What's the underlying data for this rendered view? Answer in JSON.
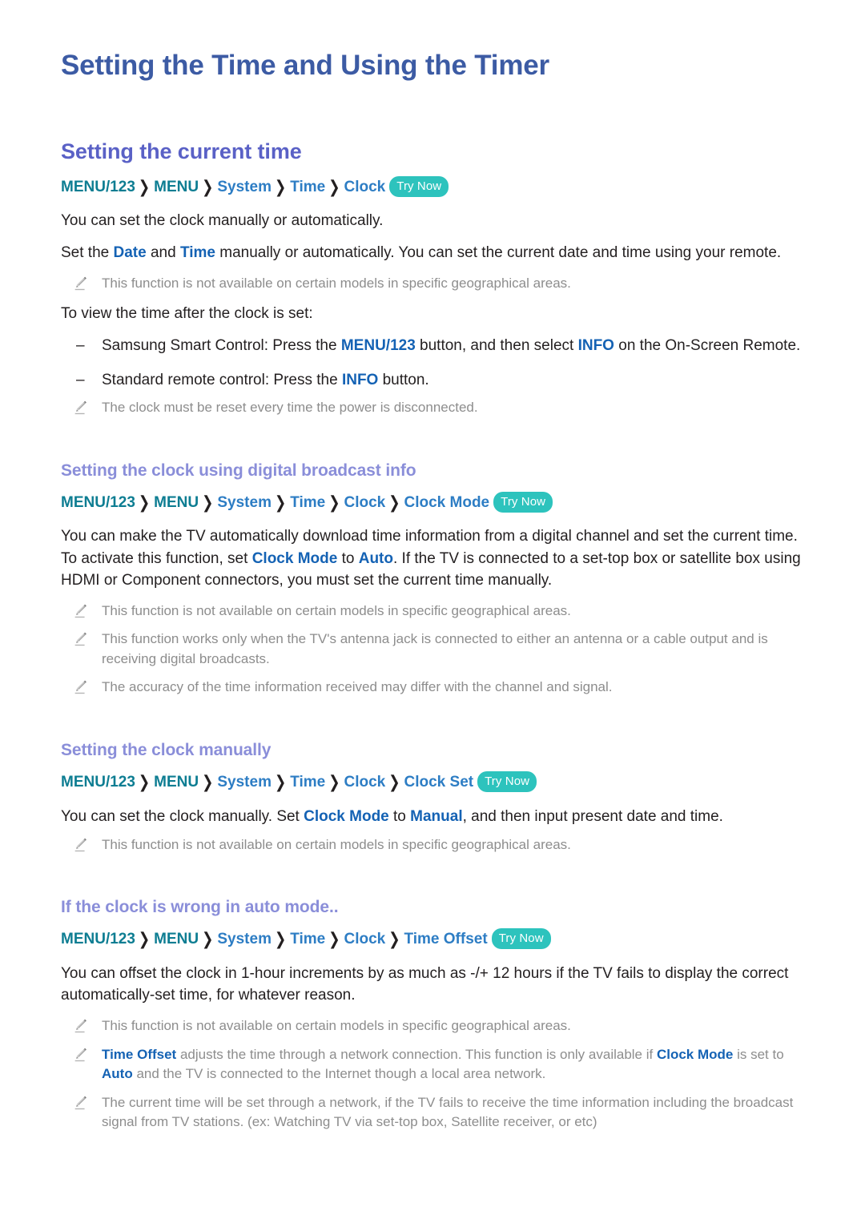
{
  "document": {
    "title": "Setting the Time and Using the Timer"
  },
  "icons": {
    "note": "pencil-icon",
    "separator": "chevron-right-icon"
  },
  "colors": {
    "doc_title": "#3c5ba4",
    "h2": "#5a61c6",
    "h3": "#8a8ed9",
    "crumb_teal": "#0d7d92",
    "crumb_blue": "#2d7dc4",
    "try_now_bg": "#2dc3bd",
    "term_blue": "#1462b4",
    "note_gray": "#8d8d8d",
    "body_text": "#231f20"
  },
  "labels": {
    "try_now": "Try Now",
    "separator": "❯",
    "dash": "–"
  },
  "sections": {
    "current_time": {
      "heading": "Setting the current time",
      "breadcrumb": [
        "MENU/123",
        "MENU",
        "System",
        "Time",
        "Clock"
      ],
      "p1": "You can set the clock manually or automatically.",
      "p2_a": "Set the ",
      "p2_term1": "Date",
      "p2_b": " and ",
      "p2_term2": "Time",
      "p2_c": " manually or automatically. You can set the current date and time using your remote.",
      "note1": "This function is not available on certain models in specific geographical areas.",
      "p3": "To view the time after the clock is set:",
      "bullet1_a": "Samsung Smart Control: Press the ",
      "bullet1_term1": "MENU/123",
      "bullet1_b": " button, and then select ",
      "bullet1_term2": "INFO",
      "bullet1_c": " on the On-Screen Remote.",
      "bullet2_a": "Standard remote control: Press the ",
      "bullet2_term1": "INFO",
      "bullet2_b": " button.",
      "note2": "The clock must be reset every time the power is disconnected."
    },
    "digital_broadcast": {
      "heading": "Setting the clock using digital broadcast info",
      "breadcrumb": [
        "MENU/123",
        "MENU",
        "System",
        "Time",
        "Clock",
        "Clock Mode"
      ],
      "p1_a": "You can make the TV automatically download time information from a digital channel and set the current time. To activate this function, set ",
      "p1_term1": "Clock Mode",
      "p1_b": " to ",
      "p1_term2": "Auto",
      "p1_c": ". If the TV is connected to a set-top box or satellite box using HDMI or Component connectors, you must set the current time manually.",
      "note1": "This function is not available on certain models in specific geographical areas.",
      "note2": "This function works only when the TV's antenna jack is connected to either an antenna or a cable output and is receiving digital broadcasts.",
      "note3": "The accuracy of the time information received may differ with the channel and signal."
    },
    "manual_clock": {
      "heading": "Setting the clock manually",
      "breadcrumb": [
        "MENU/123",
        "MENU",
        "System",
        "Time",
        "Clock",
        "Clock Set"
      ],
      "p1_a": "You can set the clock manually. Set ",
      "p1_term1": "Clock Mode",
      "p1_b": " to ",
      "p1_term2": "Manual",
      "p1_c": ", and then input present date and time.",
      "note1": "This function is not available on certain models in specific geographical areas."
    },
    "wrong_clock": {
      "heading": "If the clock is wrong in auto mode..",
      "breadcrumb": [
        "MENU/123",
        "MENU",
        "System",
        "Time",
        "Clock",
        "Time Offset"
      ],
      "p1": "You can offset the clock in 1-hour increments by as much as -/+ 12 hours if the TV fails to display the correct automatically-set time, for whatever reason.",
      "note1": "This function is not available on certain models in specific geographical areas.",
      "note2_term1": "Time Offset",
      "note2_a": " adjusts the time through a network connection. This function is only available if ",
      "note2_term2": "Clock Mode",
      "note2_b": " is set to ",
      "note2_term3": "Auto",
      "note2_c": " and the TV is connected to the Internet though a local area network.",
      "note3": "The current time will be set through a network, if the TV fails to receive the time information including the broadcast signal from TV stations. (ex: Watching TV via set-top box, Satellite receiver, or etc)"
    }
  }
}
